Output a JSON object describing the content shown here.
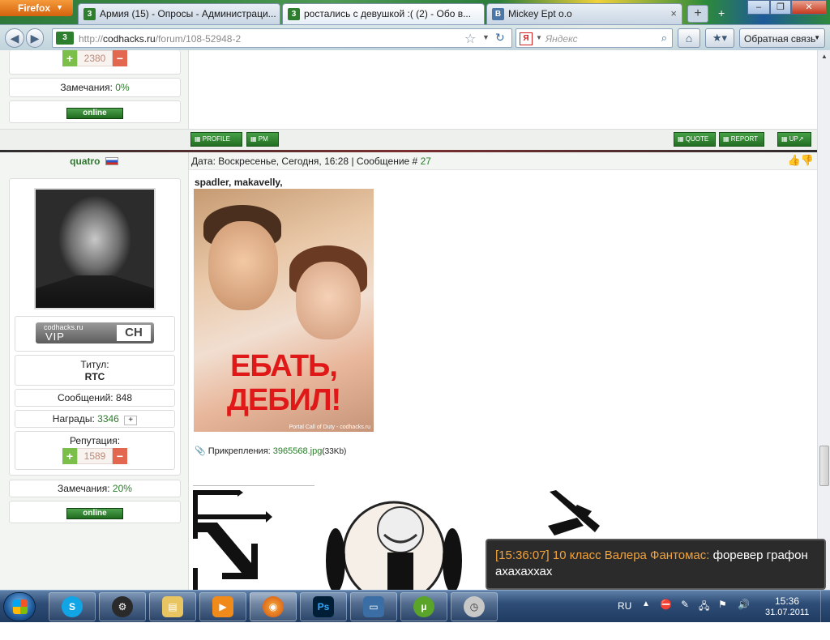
{
  "browser": {
    "app_menu": "Firefox",
    "tabs": [
      {
        "label": "Армия (15) - Опросы - Администраци...",
        "favicon": "3"
      },
      {
        "label": "ростались с девушкой :( (2) - Обо в...",
        "favicon": "3"
      },
      {
        "label": "Mickey Ept o.o",
        "favicon": "B"
      }
    ],
    "url_prefix": "http://",
    "url_domain": "codhacks.ru",
    "url_path": "/forum/108-52948-2",
    "search_engine": "Я",
    "search_placeholder": "Яндекс",
    "feedback_label": "Обратная связь"
  },
  "prev_post": {
    "reputation_value": "2380",
    "remarks_label": "Замечания:",
    "remarks_value": "0%",
    "online_label": "online",
    "actions": {
      "profile": "PROFILE",
      "pm": "PM",
      "quote": "QUOTE",
      "report": "REPORT",
      "up": "UP"
    }
  },
  "post": {
    "username": "quatro",
    "date_label": "Дата:",
    "date_value": "Воскресенье, Сегодня, 16:28",
    "msg_label": "Сообщение #",
    "msg_number": "27",
    "vip_site": "codhacks.ru",
    "vip_label": "VIP",
    "vip_logo": "CH",
    "title_label": "Титул:",
    "title_value": "RTC",
    "messages_label": "Сообщений:",
    "messages_value": "848",
    "awards_label": "Награды:",
    "awards_value": "3346",
    "reputation_label": "Репутация:",
    "reputation_value": "1589",
    "remarks_label": "Замечания:",
    "remarks_value": "20%",
    "online_label": "online",
    "reply_to_1": "spadler",
    "reply_to_2": "makavelly",
    "image_caption_line1": "ЕБАТЬ,",
    "image_caption_line2": "ДЕБИЛ!",
    "image_credit": "Portal Call of Duty - codhacks.ru",
    "attachments_label": "Прикрепления:",
    "attachment_file": "3965568.jpg",
    "attachment_size": "(33Kb)"
  },
  "notification": {
    "timestamp": "[15:36:07]",
    "sender": "10 класс Валера Фантомас:",
    "message": "форевер графон ахахаххах"
  },
  "taskbar": {
    "language": "RU",
    "time": "15:36",
    "date": "31.07.2011"
  },
  "colors": {
    "accent_green": "#2b7a2b",
    "button_green": "#2f8a2f",
    "notify_timestamp": "#f2a23a"
  }
}
